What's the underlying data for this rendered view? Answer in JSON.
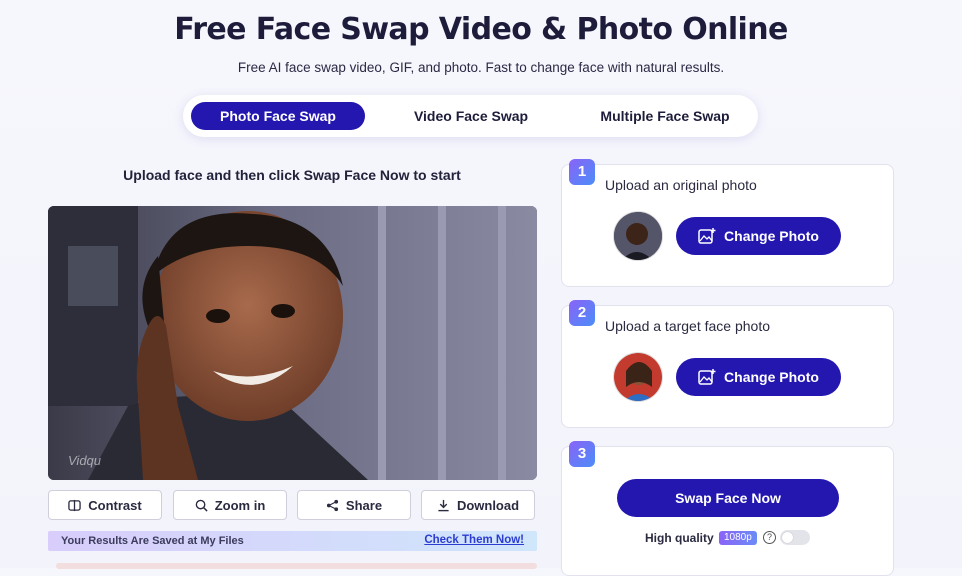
{
  "header": {
    "title": "Free Face Swap Video & Photo Online",
    "subtitle": "Free AI face swap video, GIF, and photo. Fast to change face with natural results."
  },
  "tabs": [
    {
      "label": "Photo Face Swap",
      "active": true
    },
    {
      "label": "Video Face Swap",
      "active": false
    },
    {
      "label": "Multiple Face Swap",
      "active": false
    }
  ],
  "left": {
    "instruction": "Upload face and then click Swap Face Now to start",
    "watermark": "Vidqu",
    "toolbar": {
      "contrast": "Contrast",
      "zoom": "Zoom in",
      "share": "Share",
      "download": "Download"
    },
    "saved_banner": {
      "text": "Your Results Are Saved at My Files",
      "link": "Check Them Now!"
    }
  },
  "steps": [
    {
      "number": "1",
      "label": "Upload an original photo",
      "button": "Change Photo"
    },
    {
      "number": "2",
      "label": "Upload a target face photo",
      "button": "Change Photo"
    },
    {
      "number": "3",
      "button": "Swap Face Now",
      "quality_label": "High quality",
      "quality_badge": "1080p",
      "help": "?"
    }
  ],
  "colors": {
    "primary": "#2417b0",
    "step_gradient_start": "#8a63f7",
    "step_gradient_end": "#4b8df8",
    "link": "#2c3cd0"
  }
}
